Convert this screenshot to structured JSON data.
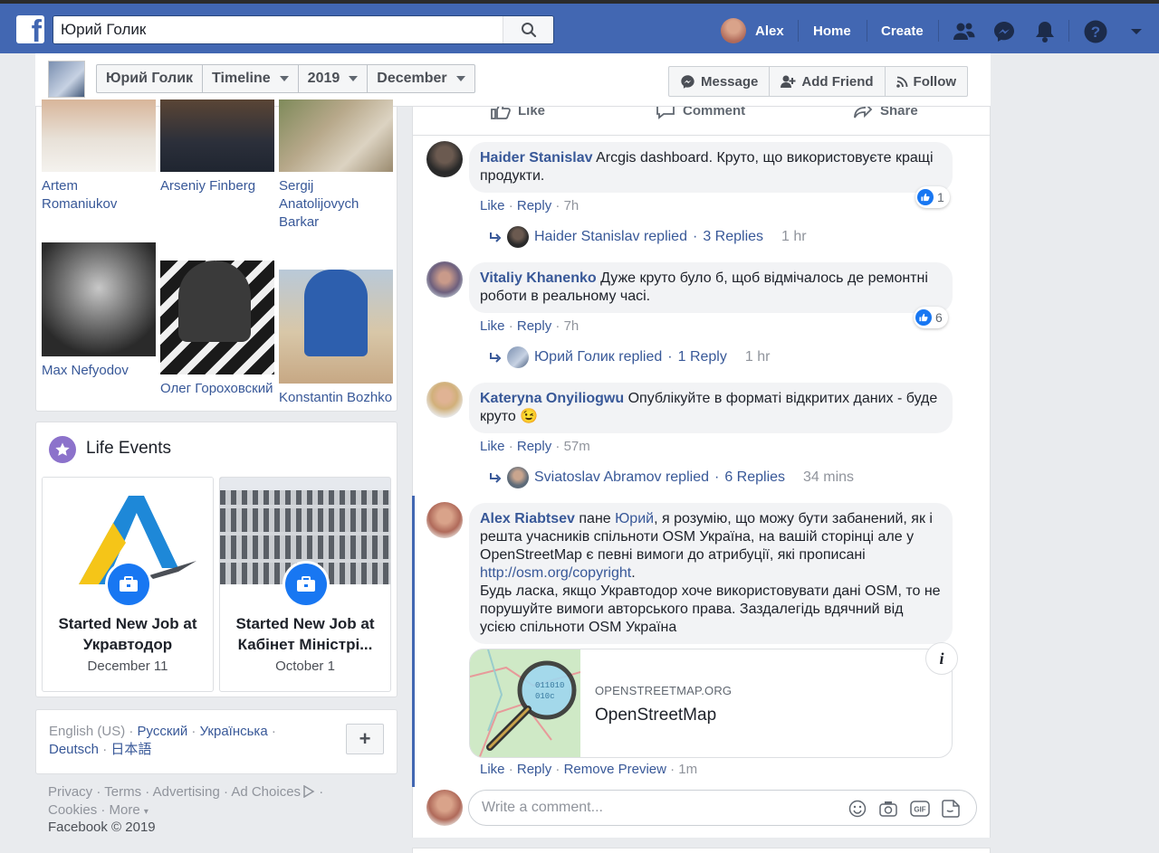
{
  "topbar": {
    "logo": "f",
    "search_value": "Юрий Голик",
    "user_name": "Alex",
    "nav_home": "Home",
    "nav_create": "Create",
    "accent": "#4267b2"
  },
  "profile_bar": {
    "breadcrumb": [
      "Юрий Голик",
      "Timeline",
      "2019",
      "December"
    ],
    "actions": [
      "Message",
      "Add Friend",
      "Follow"
    ]
  },
  "friends": [
    {
      "name": "Artem Romaniukov"
    },
    {
      "name": "Arseniy Finberg"
    },
    {
      "name": "Sergij Anatolijovych Barkar"
    },
    {
      "name": "Max Nefyodov"
    },
    {
      "name": "Олег Гороховский"
    },
    {
      "name": "Konstantin Bozhko"
    }
  ],
  "life_events": {
    "title": "Life Events",
    "items": [
      {
        "title": "Started New Job at Укравтодор",
        "date": "December 11"
      },
      {
        "title": "Started New Job at Кабінет Міністрі...",
        "date": "October 1"
      }
    ]
  },
  "languages": {
    "current": "English (US)",
    "sep": " · ",
    "others": [
      "Русский",
      "Українська",
      "Deutsch",
      "日本語"
    ],
    "add_label": "+"
  },
  "footer": {
    "links": [
      "Privacy",
      "Terms",
      "Advertising",
      "Ad Choices",
      "Cookies",
      "More"
    ],
    "copyright": "Facebook © 2019"
  },
  "post_actions": [
    "Like",
    "Comment",
    "Share"
  ],
  "comments": [
    {
      "author": "Haider Stanislav",
      "text": "Arcgis dashboard. Круто, що використовуєте кращі продукти.",
      "like": "Like",
      "reply": "Reply",
      "time": "7h",
      "reactions": "1",
      "replies": {
        "who": "Haider Stanislav replied",
        "count": "3 Replies",
        "time": "1 hr"
      }
    },
    {
      "author": "Vitaliy Khanenko",
      "text": "Дуже круто було б, щоб відмічалось де ремонтні роботи в реальному часі.",
      "like": "Like",
      "reply": "Reply",
      "time": "7h",
      "reactions": "6",
      "replies": {
        "who": "Юрий Голик replied",
        "count": "1 Reply",
        "time": "1 hr"
      }
    },
    {
      "author": "Kateryna Onyiliogwu",
      "text": "Опублікуйте в форматі відкритих даних - буде круто 😉",
      "like": "Like",
      "reply": "Reply",
      "time": "57m",
      "replies": {
        "who": "Sviatoslav Abramov replied",
        "count": "6 Replies",
        "time": "34 mins"
      }
    },
    {
      "author": "Alex Riabtsev",
      "text_pre": "пане",
      "mention": "Юрий",
      "text_mid": ", я розумію, що можу бути забанений, як і решта учасників спільноти OSM Україна, на вашій сторінці але у OpenStreetMap є певні вимоги до атрибуції, які прописані",
      "link": "http://osm.org/copyright",
      "text_after": "Будь ласка, якщо Укравтодор хоче використовувати дані OSM, то не порушуйте вимоги авторського права. Заздалегідь вдячний від усією спільноти OSM Україна",
      "like": "Like",
      "reply": "Reply",
      "remove_preview": "Remove Preview",
      "time": "1m",
      "preview": {
        "domain": "OPENSTREETMAP.ORG",
        "title": "OpenStreetMap"
      }
    }
  ],
  "composer": {
    "placeholder": "Write a comment..."
  }
}
